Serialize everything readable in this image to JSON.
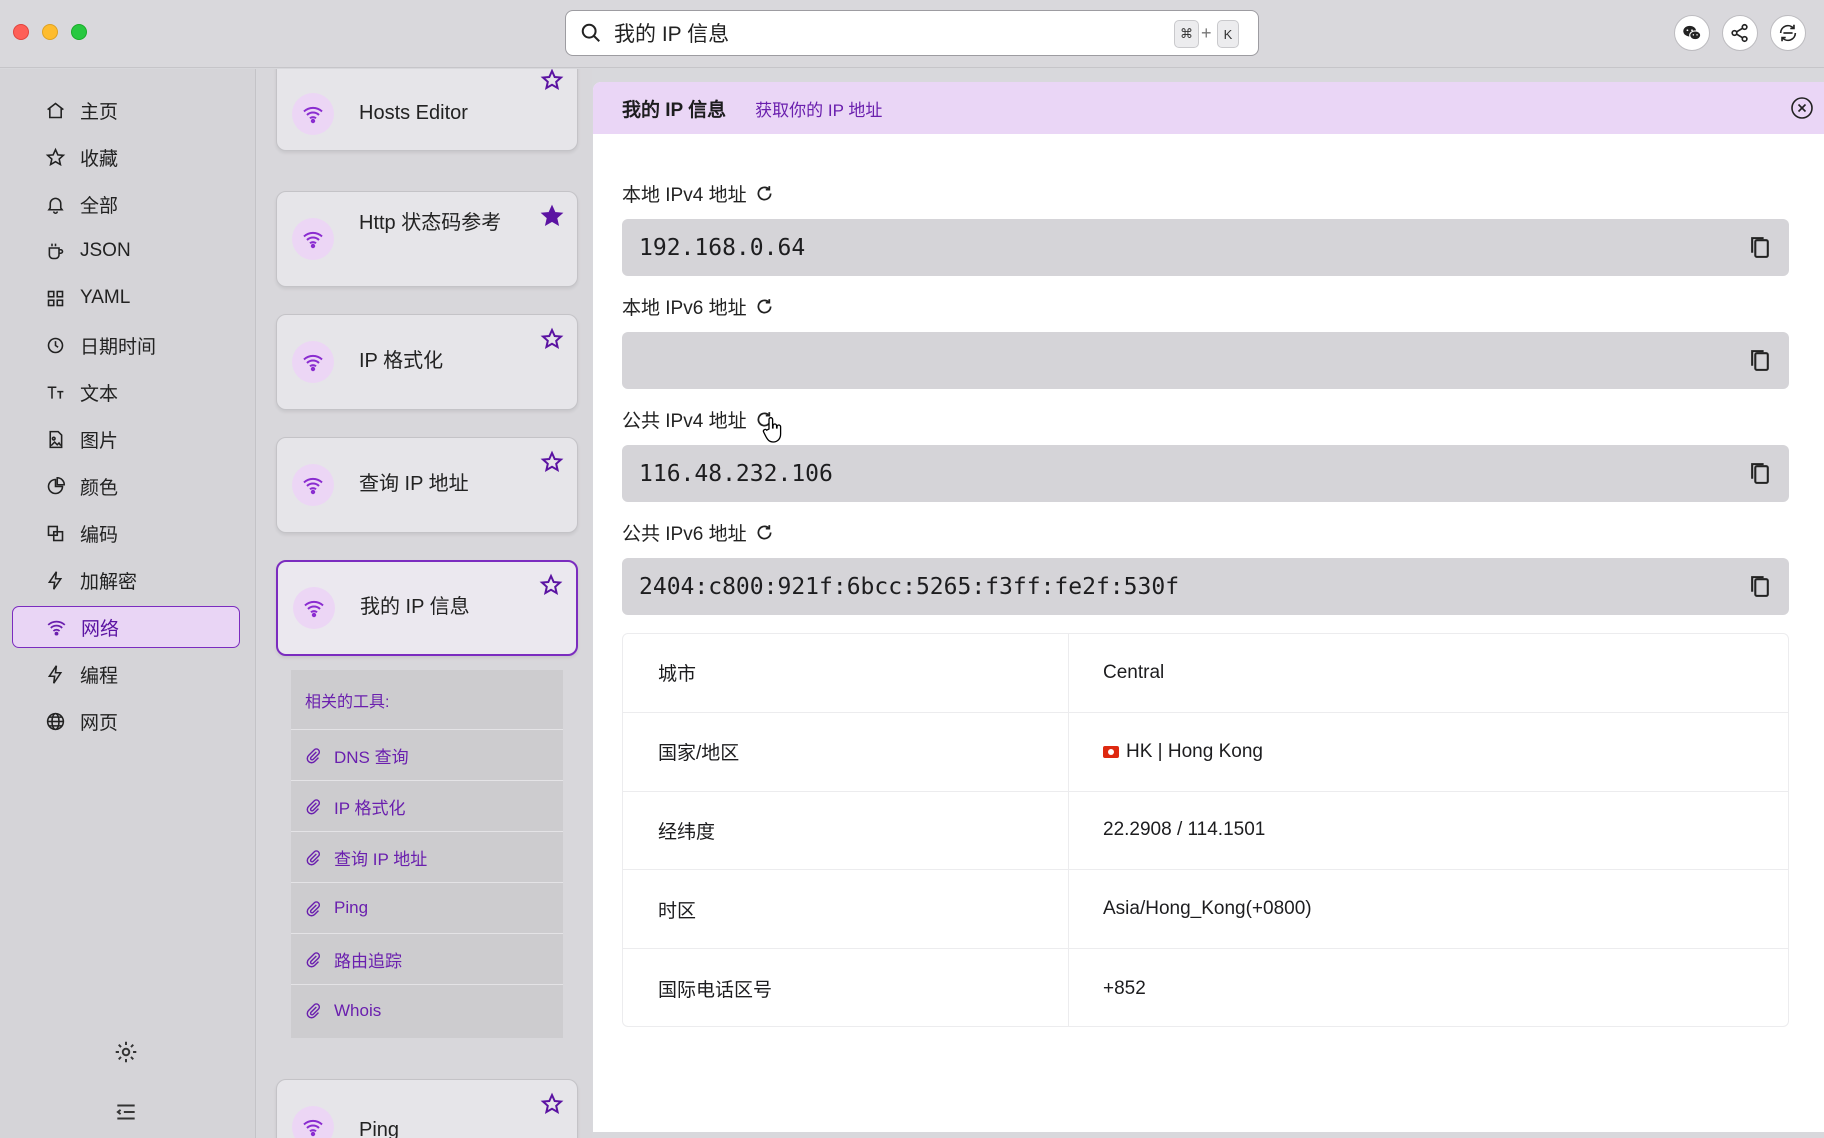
{
  "search": {
    "query": "我的 IP 信息",
    "shortcut_cmd": "⌘",
    "shortcut_plus": "+",
    "shortcut_key": "K"
  },
  "sidebar": {
    "items": [
      {
        "label": "主页",
        "icon": "home-icon"
      },
      {
        "label": "收藏",
        "icon": "star-icon"
      },
      {
        "label": "全部",
        "icon": "bell-icon"
      },
      {
        "label": "JSON",
        "icon": "cup-icon"
      },
      {
        "label": "YAML",
        "icon": "grid-icon"
      },
      {
        "label": "日期时间",
        "icon": "clock-icon"
      },
      {
        "label": "文本",
        "icon": "text-icon"
      },
      {
        "label": "图片",
        "icon": "image-file-icon"
      },
      {
        "label": "颜色",
        "icon": "pie-icon"
      },
      {
        "label": "编码",
        "icon": "encode-icon"
      },
      {
        "label": "加解密",
        "icon": "bolt-icon"
      },
      {
        "label": "网络",
        "icon": "wifi-icon",
        "active": true
      },
      {
        "label": "编程",
        "icon": "bolt-icon"
      },
      {
        "label": "网页",
        "icon": "globe-icon"
      }
    ]
  },
  "tools": {
    "cards": [
      {
        "title": "Hosts Editor",
        "starred": false
      },
      {
        "title": "Http 状态码参考",
        "starred": true
      },
      {
        "title": "IP 格式化",
        "starred": false
      },
      {
        "title": "查询 IP 地址",
        "starred": false
      },
      {
        "title": "我的 IP 信息",
        "starred": false,
        "active": true
      },
      {
        "title": "Ping",
        "starred": false
      }
    ],
    "related": {
      "heading": "相关的工具:",
      "items": [
        "DNS 查询",
        "IP 格式化",
        "查询 IP 地址",
        "Ping",
        "路由追踪",
        "Whois"
      ]
    }
  },
  "main": {
    "title": "我的 IP 信息",
    "subtitle": "获取你的 IP 地址",
    "fields": [
      {
        "label": "本地 IPv4 地址",
        "value": "192.168.0.64"
      },
      {
        "label": "本地 IPv6 地址",
        "value": ""
      },
      {
        "label": "公共 IPv4 地址",
        "value": "116.48.232.106"
      },
      {
        "label": "公共 IPv6 地址",
        "value": "2404:c800:921f:6bcc:5265:f3ff:fe2f:530f"
      }
    ],
    "info": [
      {
        "key": "城市",
        "value": "Central"
      },
      {
        "key": "国家/地区",
        "value": "HK | Hong Kong",
        "flag": true
      },
      {
        "key": "经纬度",
        "value": "22.2908 / 114.1501"
      },
      {
        "key": "时区",
        "value": "Asia/Hong_Kong(+0800)"
      },
      {
        "key": "国际电话区号",
        "value": "+852"
      }
    ]
  },
  "colors": {
    "accent": "#7b2cbf",
    "accent_light": "#ead6f6",
    "field_bg": "#d5d4d8"
  }
}
